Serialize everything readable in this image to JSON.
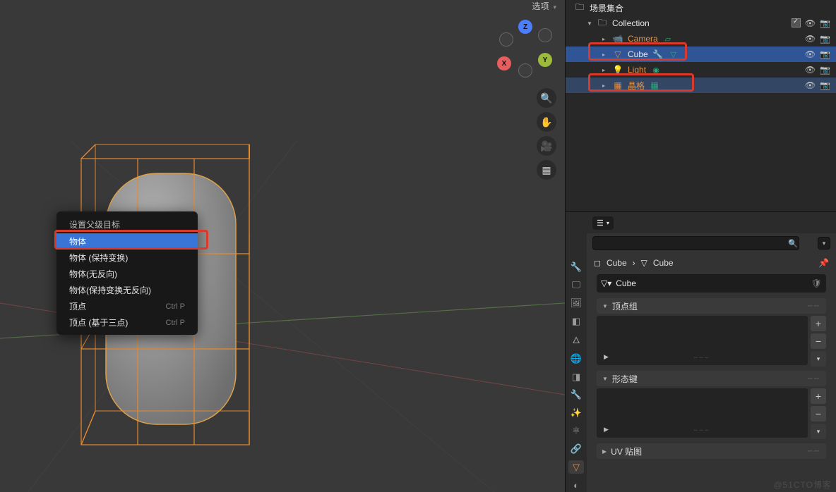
{
  "viewport": {
    "options_label": "选项",
    "gizmo": {
      "x": "X",
      "y": "Y",
      "z": "Z"
    }
  },
  "outliner": {
    "scene_collection": "场景集合",
    "collection": "Collection",
    "items": [
      {
        "name": "Camera"
      },
      {
        "name": "Cube"
      },
      {
        "name": "Light"
      },
      {
        "name": "晶格"
      }
    ]
  },
  "context_menu": {
    "title": "设置父级目标",
    "items": [
      {
        "label": "物体",
        "shortcut": "",
        "hot": true
      },
      {
        "label": "物体 (保持变换)",
        "shortcut": ""
      },
      {
        "label": "物体(无反向)",
        "shortcut": ""
      },
      {
        "label": "物体(保持变换无反向)",
        "shortcut": ""
      },
      {
        "label": "顶点",
        "shortcut": "Ctrl P"
      },
      {
        "label": "顶点 (基于三点)",
        "shortcut": "Ctrl P"
      }
    ]
  },
  "properties": {
    "breadcrumb": {
      "obj": "Cube",
      "data": "Cube"
    },
    "name_field": "Cube",
    "sections": {
      "vertex_groups": "顶点组",
      "shape_keys": "形态键",
      "uv_maps": "UV 贴图"
    }
  },
  "watermark": "@51CTO博客"
}
